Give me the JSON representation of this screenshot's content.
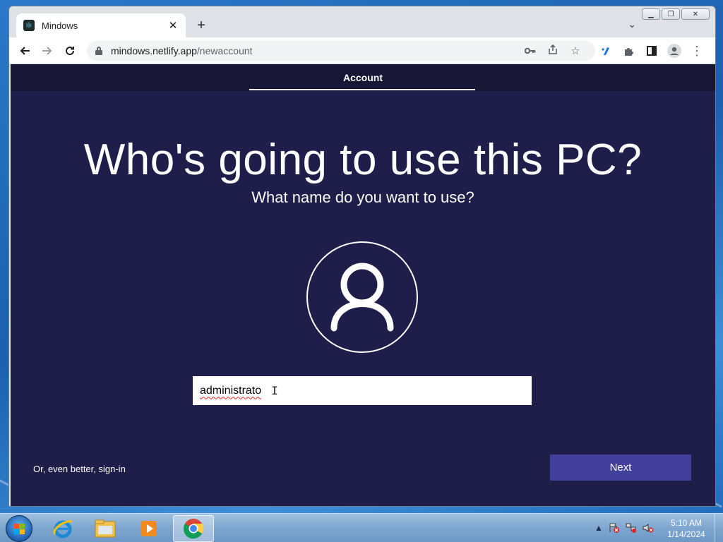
{
  "browser": {
    "tab": {
      "title": "Mindows",
      "favicon": "react-logo-icon"
    },
    "new_tab_symbol": "+",
    "url_host": "mindows.netlify.app",
    "url_path": "/newaccount"
  },
  "page": {
    "step_label": "Account",
    "headline": "Who's going to use this PC?",
    "subhead": "What name do you want to use?",
    "name_input_value": "administrato",
    "signin_link": "Or, even better, sign-in",
    "next_label": "Next",
    "colors": {
      "background": "#1f1e4a",
      "topbar": "#171634",
      "next_button": "#413f9a"
    }
  },
  "taskbar": {
    "apps": [
      "internet-explorer-icon",
      "file-explorer-icon",
      "media-player-icon",
      "chrome-icon"
    ],
    "active_app": "chrome-icon",
    "clock_time": "5:10 AM",
    "clock_date": "1/14/2024"
  }
}
